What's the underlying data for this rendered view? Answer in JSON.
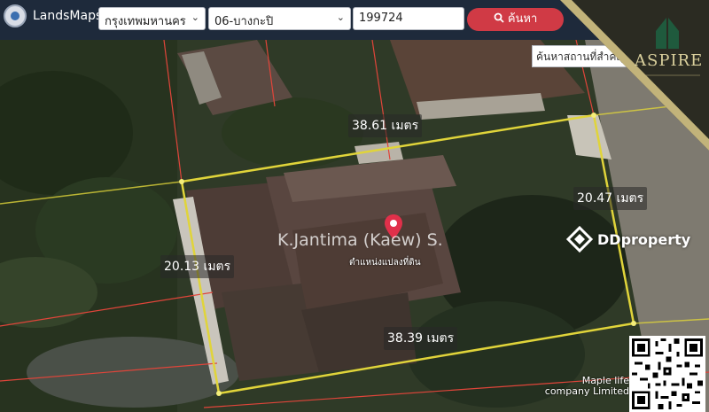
{
  "header": {
    "brand": "LandsMaps",
    "province": "กรุงเทพมหานคร",
    "district": "06-บางกะปิ",
    "parcel_number": "199724",
    "search_button": "ค้นหา",
    "search_icon": "search-icon"
  },
  "place_search": {
    "placeholder": "ค้นหาสถานที่สำคัญ"
  },
  "aspire_logo": {
    "text": "ASPIRE"
  },
  "parcel": {
    "side_top": "38.61 เมตร",
    "side_right": "20.47 เมตร",
    "side_left": "20.13 เมตร",
    "side_bottom": "38.39 เมตร",
    "marker_label": "ตำแหน่งแปลงที่ดิน",
    "marker_icon": "location-pin-icon"
  },
  "watermark": {
    "text": "K.Jantima (Kaew) S."
  },
  "ddproperty": {
    "text": "DDproperty"
  },
  "credit": {
    "line1": "Maple life",
    "line2": "company Limited"
  },
  "colors": {
    "header_bg": "#1e2a3b",
    "search_button": "#d03a45",
    "parcel_outline": "#e0d43a",
    "boundary_red": "#e0453a"
  }
}
